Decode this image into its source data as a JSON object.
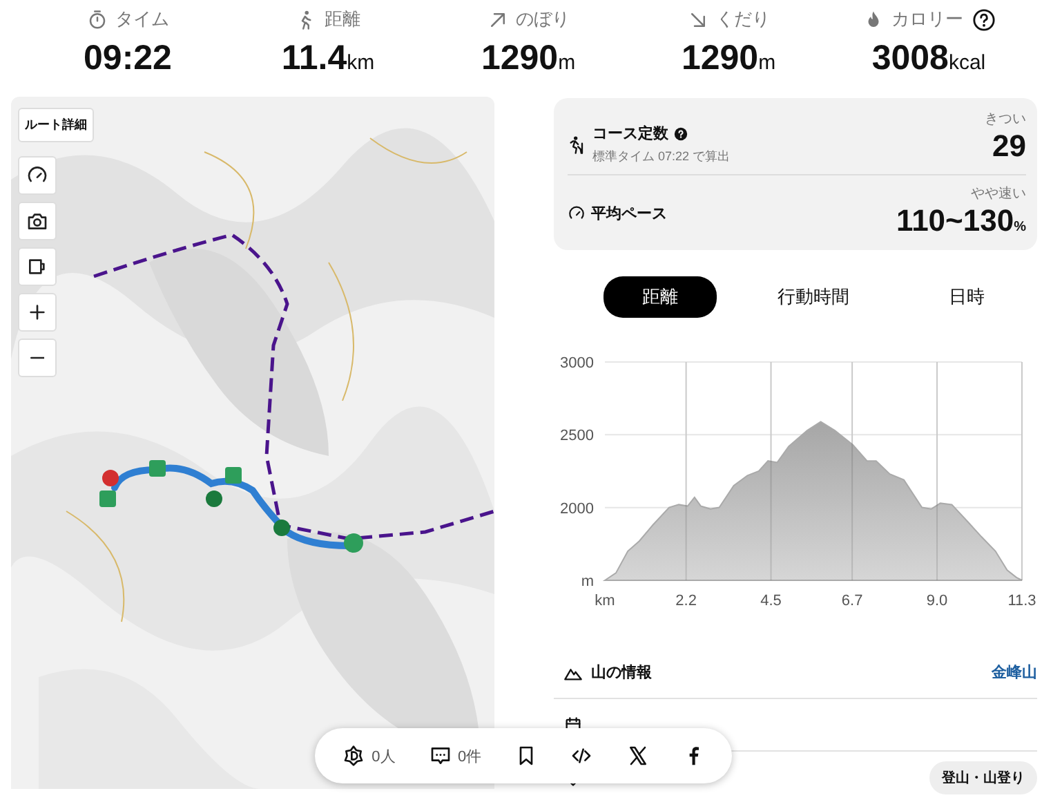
{
  "stats": [
    {
      "kind": "time",
      "label": "タイム",
      "value": "09:22"
    },
    {
      "kind": "distance",
      "label": "距離",
      "value": "11.4",
      "unit": "km"
    },
    {
      "kind": "up",
      "label": "のぼり",
      "value": "1290",
      "unit": "m"
    },
    {
      "kind": "down",
      "label": "くだり",
      "value": "1290",
      "unit": "m"
    },
    {
      "kind": "calorie",
      "label": "カロリー",
      "value": "3008",
      "unit": "kcal",
      "help": true
    }
  ],
  "map": {
    "kind": "picture",
    "route_button": "ルート詳細",
    "controls": [
      {
        "kind": "gauge"
      },
      {
        "kind": "camera"
      },
      {
        "kind": "cup"
      },
      {
        "kind": "plus"
      },
      {
        "kind": "minus"
      }
    ]
  },
  "summary": [
    {
      "kind": "hiker",
      "title": "コース定数",
      "help": true,
      "subtitle": "標準タイム 07:22 で算出",
      "rating": "きつい",
      "value": "29"
    },
    {
      "kind": "gauge",
      "title": "平均ペース",
      "help": false,
      "rating": "やや速い",
      "value": "110~130",
      "unit": "%"
    }
  ],
  "tabs": [
    {
      "label": "距離",
      "selected": true
    },
    {
      "label": "行動時間",
      "selected": false
    },
    {
      "label": "日時",
      "selected": false
    }
  ],
  "chart_data": {
    "type": "area",
    "xlim": [
      0,
      11.3
    ],
    "ylim": [
      1500,
      3000
    ],
    "xticks": [
      {
        "value": 0,
        "label": "km"
      },
      {
        "value": 2.2,
        "label": "2.2"
      },
      {
        "value": 4.5,
        "label": "4.5"
      },
      {
        "value": 6.7,
        "label": "6.7"
      },
      {
        "value": 9.0,
        "label": "9.0"
      },
      {
        "value": 11.3,
        "label": "11.3"
      }
    ],
    "yticks": [
      {
        "value": 1500,
        "label": "m"
      },
      {
        "value": 2000,
        "label": "2000"
      },
      {
        "value": 2500,
        "label": "2500"
      },
      {
        "value": 3000,
        "label": "3000"
      }
    ],
    "x": [
      0,
      0.3,
      0.62,
      0.93,
      1.3,
      1.74,
      2.0,
      2.24,
      2.43,
      2.6,
      2.86,
      3.1,
      3.49,
      3.86,
      4.17,
      4.42,
      4.67,
      4.98,
      5.48,
      5.85,
      6.23,
      6.72,
      7.1,
      7.35,
      7.72,
      8.1,
      8.59,
      8.84,
      9.09,
      9.4,
      9.84,
      10.2,
      10.58,
      10.9,
      11.15,
      11.3
    ],
    "grid": true,
    "series": [
      {
        "color": "#aaaaaa",
        "values": [
          1500,
          1550,
          1700,
          1770,
          1880,
          2000,
          2020,
          2010,
          2070,
          2010,
          1990,
          2000,
          2150,
          2220,
          2250,
          2320,
          2310,
          2420,
          2530,
          2590,
          2530,
          2430,
          2320,
          2320,
          2230,
          2190,
          2000,
          1990,
          2030,
          2020,
          1900,
          1800,
          1700,
          1570,
          1520,
          1500
        ]
      }
    ]
  },
  "info": [
    {
      "kind": "mountain",
      "label": "山の情報",
      "value": "金峰山"
    },
    {
      "kind": "calendar"
    },
    {
      "kind": "tag",
      "tags": [
        "登山・山登り"
      ]
    }
  ],
  "share_bar": [
    {
      "kind": "clip",
      "text": "0人"
    },
    {
      "kind": "comment",
      "text": "0件"
    },
    {
      "kind": "bookmark"
    },
    {
      "kind": "embed"
    },
    {
      "kind": "x"
    },
    {
      "kind": "facebook"
    }
  ]
}
